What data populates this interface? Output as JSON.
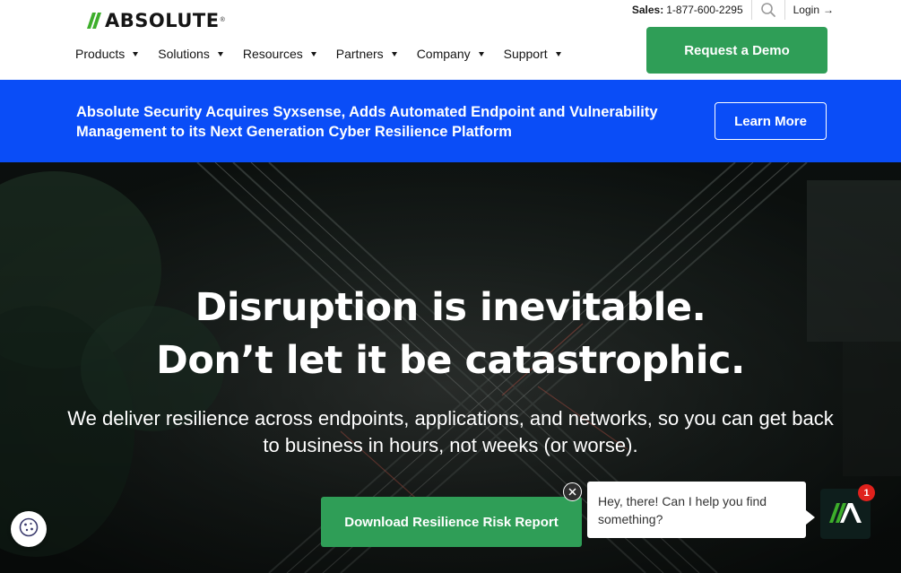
{
  "brand": {
    "name": "ABSOLUTE",
    "registered_mark": "®",
    "logo_icon": "absolute-slash-logo-icon",
    "accent_green": "#2f9e57"
  },
  "utility": {
    "sales_label": "Sales:",
    "sales_number": "1-877-600-2295",
    "search_icon": "search-icon",
    "login_label": "Login",
    "login_arrow": "→"
  },
  "nav": {
    "items": [
      {
        "label": "Products"
      },
      {
        "label": "Solutions"
      },
      {
        "label": "Resources"
      },
      {
        "label": "Partners"
      },
      {
        "label": "Company"
      },
      {
        "label": "Support"
      }
    ],
    "demo_label": "Request a Demo"
  },
  "announcement": {
    "background": "#0a4df7",
    "line1": "Absolute Security Acquires Syxsense, Adds Automated Endpoint and Vulnerability",
    "line2": "Management to its Next Generation Cyber Resilience Platform",
    "button_label": "Learn More"
  },
  "hero": {
    "title_line1": "Disruption is inevitable.",
    "title_line2": "Don’t let it be catastrophic.",
    "subtitle_line1": "We deliver resilience across endpoints, applications, and networks, so you can get back",
    "subtitle_line2": "to business in hours, not weeks (or worse).",
    "cta_label": "Download Resilience Risk Report"
  },
  "chat": {
    "message": "Hey, there! Can I help you find something?",
    "close_icon": "close-icon",
    "launcher_icon": "absolute-logo-icon",
    "badge_count": "1"
  },
  "cookie": {
    "icon": "cookie-icon"
  }
}
